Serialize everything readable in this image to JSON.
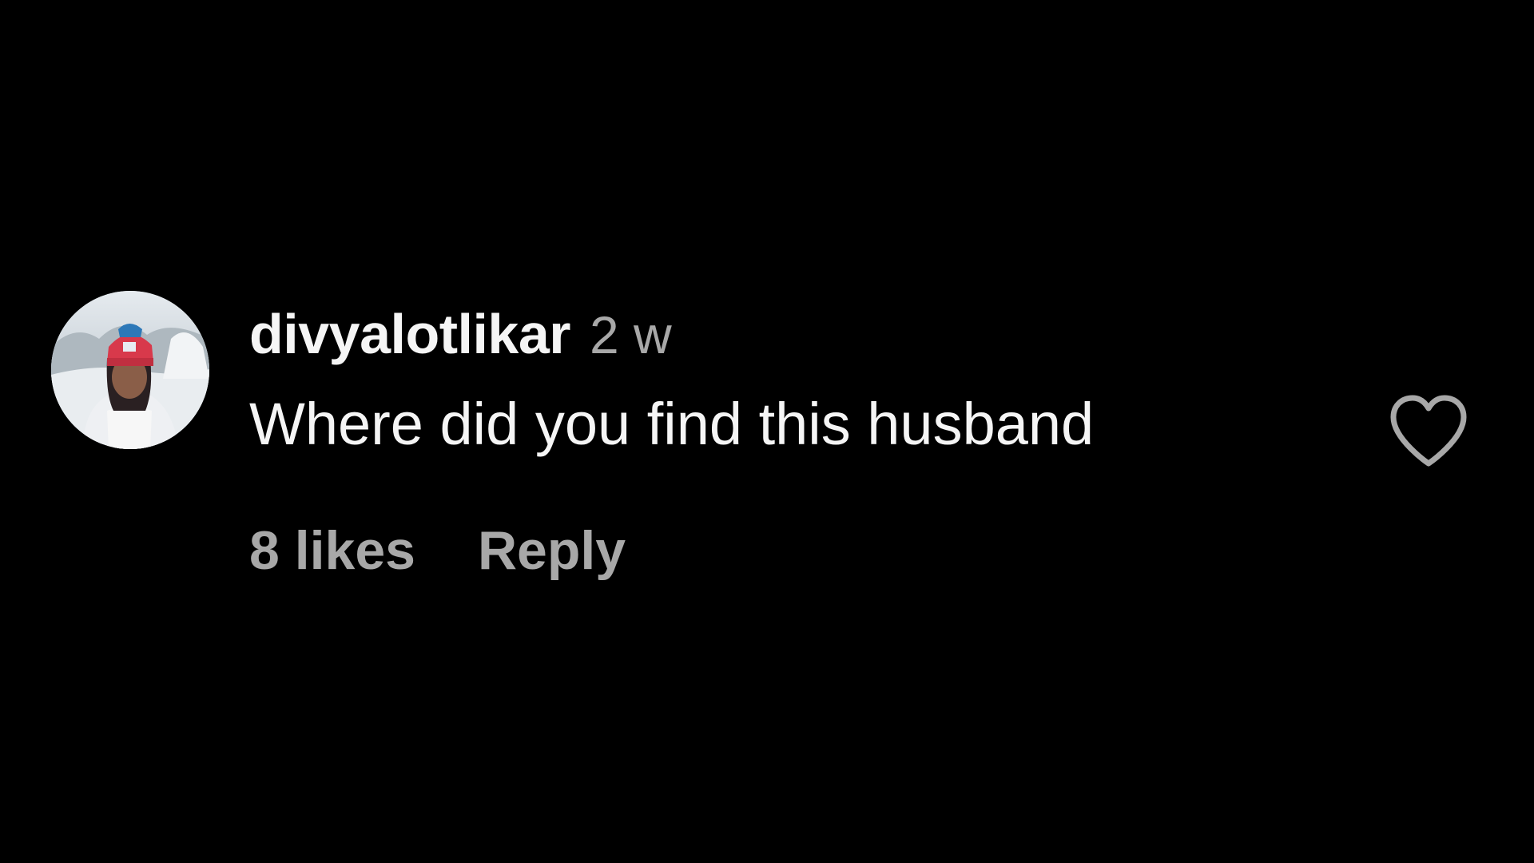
{
  "comment": {
    "username": "divyalotlikar",
    "timestamp": "2 w",
    "text": "Where did you find this husband",
    "likes_label": "8 likes",
    "reply_label": "Reply",
    "like_icon": "heart-outline-icon"
  },
  "colors": {
    "background": "#000000",
    "primary_text": "#f5f5f5",
    "secondary_text": "#a8a8a8"
  }
}
